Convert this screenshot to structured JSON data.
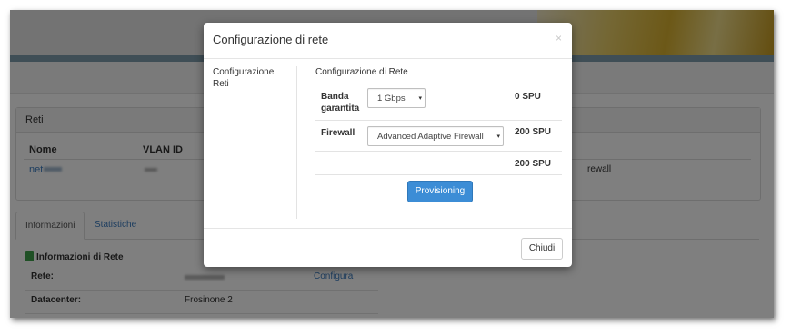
{
  "page": {
    "panel_title": "Reti",
    "table": {
      "headers": [
        "Nome",
        "VLAN ID"
      ],
      "row": {
        "name": "net",
        "vlan": "",
        "right_text": "rewall"
      }
    },
    "tabs": [
      {
        "label": "Informazioni"
      },
      {
        "label": "Statistiche"
      }
    ],
    "info": {
      "title": "Informazioni di Rete",
      "rows": [
        {
          "key": "Rete:",
          "value": "",
          "action": "Configura"
        },
        {
          "key": "Datacenter:",
          "value": "Frosinone 2",
          "action": ""
        }
      ]
    }
  },
  "modal": {
    "title": "Configurazione di rete",
    "close": "×",
    "nav": [
      "Configurazione",
      "Reti"
    ],
    "section_title": "Configurazione di Rete",
    "rows": [
      {
        "label": "Banda garantita",
        "select": "1 Gbps",
        "spu": "0 SPU"
      },
      {
        "label": "Firewall",
        "select": "Advanced Adaptive Firewall",
        "spu": "200 SPU"
      },
      {
        "label": "",
        "select": "",
        "spu": "200 SPU"
      }
    ],
    "provision_button": "Provisioning",
    "close_button": "Chiudi"
  },
  "colors": {
    "primary": "#3c8dd6",
    "link": "#3a7bbf",
    "status_green": "#3fa14a"
  }
}
